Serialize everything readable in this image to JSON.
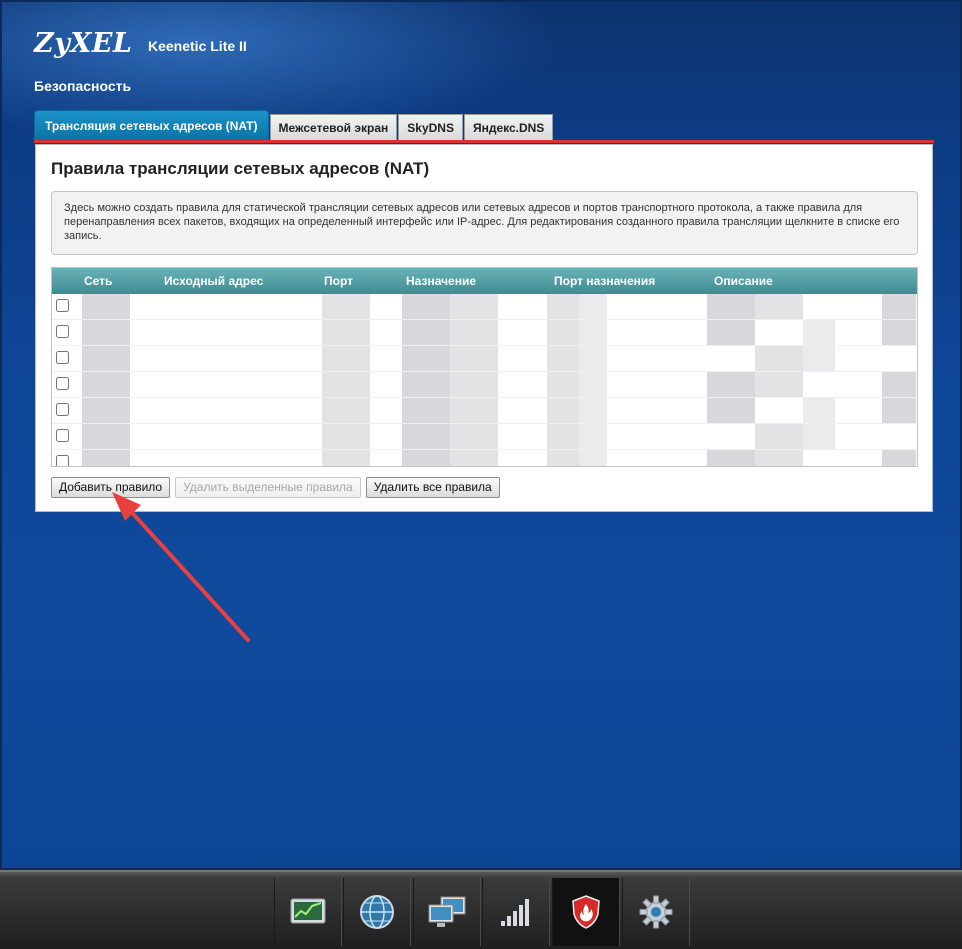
{
  "header": {
    "brand": "ZyXEL",
    "model": "Keenetic Lite II",
    "section": "Безопасность"
  },
  "tabs": [
    {
      "label": "Трансляция сетевых адресов (NAT)",
      "active": true
    },
    {
      "label": "Межсетевой экран",
      "active": false
    },
    {
      "label": "SkyDNS",
      "active": false
    },
    {
      "label": "Яндекс.DNS",
      "active": false
    }
  ],
  "panel": {
    "title": "Правила трансляции сетевых адресов (NAT)",
    "info": "Здесь можно создать правила для статической трансляции сетевых адресов или сетевых адресов и портов транспортного протокола, а также правила для перенаправления всех пакетов, входящих на определенный интерфейс или IP-адрес. Для редактирования созданного правила трансляции щелкните в списке его запись."
  },
  "table": {
    "columns": [
      "Сеть",
      "Исходный адрес",
      "Порт",
      "Назначение",
      "Порт назначения",
      "Описание"
    ],
    "row_count": 7
  },
  "buttons": {
    "add": "Добавить правило",
    "delete_selected": "Удалить выделенные правила",
    "delete_all": "Удалить все правила"
  },
  "taskbar": {
    "items": [
      "monitor-icon",
      "internet-globe-icon",
      "home-network-icon",
      "wifi-signal-icon",
      "security-shield-icon",
      "settings-gear-icon"
    ],
    "active": "security-shield-icon"
  },
  "colors": {
    "active_tab": "#0b73a6",
    "accent_line": "#d93334",
    "table_header": "#4f9da3",
    "annotation_arrow": "#e8403f"
  }
}
